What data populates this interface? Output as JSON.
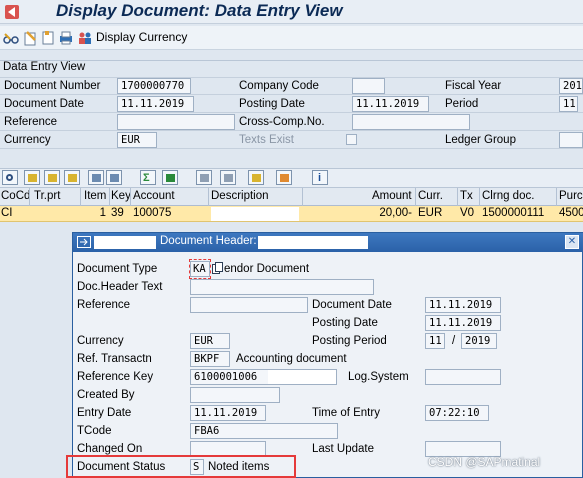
{
  "window": {
    "title": "Display Document: Data Entry View"
  },
  "toolbar": {
    "display_currency_label": "Display Currency",
    "icons": [
      "glasses-icon",
      "edit-icon",
      "document-icon",
      "print-icon",
      "people-icon"
    ]
  },
  "section": {
    "title": "Data Entry View"
  },
  "header_fields": {
    "document_number_label": "Document Number",
    "document_number_value": "1700000770",
    "company_code_label": "Company Code",
    "company_code_value": "",
    "fiscal_year_label": "Fiscal Year",
    "fiscal_year_value": "201",
    "document_date_label": "Document Date",
    "document_date_value": "11.11.2019",
    "posting_date_label": "Posting Date",
    "posting_date_value": "11.11.2019",
    "period_label": "Period",
    "period_value": "11",
    "reference_label": "Reference",
    "reference_value": "",
    "cross_comp_label": "Cross-Comp.No.",
    "cross_comp_value": "",
    "currency_label": "Currency",
    "currency_value": "EUR",
    "texts_exist_label": "Texts Exist",
    "ledger_group_label": "Ledger Group",
    "ledger_group_value": ""
  },
  "grid": {
    "columns": [
      "CoCd",
      "Tr.prt",
      "Item",
      "Key",
      "Account",
      "Description",
      "Amount",
      "Curr.",
      "Tx",
      "Clrng doc.",
      "Purc"
    ],
    "row": {
      "cocd": "CI",
      "trprt": "",
      "item": "1",
      "key": "39",
      "account": "100075",
      "description": "",
      "amount": "20,00-",
      "curr": "EUR",
      "tx": "V0",
      "clrng": "1500000111",
      "purc": "4500"
    }
  },
  "popup": {
    "title": "Document Header:",
    "document_type_label": "Document Type",
    "document_type_value": "KA",
    "document_type_desc": "endor Document",
    "doc_header_text_label": "Doc.Header Text",
    "doc_header_text_value": "",
    "reference_label": "Reference",
    "reference_value": "",
    "document_date_label": "Document Date",
    "document_date_value": "11.11.2019",
    "posting_date_label": "Posting Date",
    "posting_date_value": "11.11.2019",
    "currency_label": "Currency",
    "currency_value": "EUR",
    "posting_period_label": "Posting Period",
    "posting_period_month": "11",
    "posting_period_sep": "/",
    "posting_period_year": "2019",
    "ref_transactn_label": "Ref. Transactn",
    "ref_transactn_value": "BKPF",
    "ref_transactn_desc": "Accounting document",
    "reference_key_label": "Reference Key",
    "reference_key_value": "6100001006",
    "log_system_label": "Log.System",
    "log_system_value": "",
    "created_by_label": "Created By",
    "created_by_value": "",
    "entry_date_label": "Entry Date",
    "entry_date_value": "11.11.2019",
    "time_of_entry_label": "Time of Entry",
    "time_of_entry_value": "07:22:10",
    "tcode_label": "TCode",
    "tcode_value": "FBA6",
    "changed_on_label": "Changed On",
    "changed_on_value": "",
    "last_update_label": "Last Update",
    "last_update_value": "",
    "document_status_label": "Document Status",
    "document_status_value": "S",
    "document_status_desc": "Noted items"
  },
  "watermark": "CSDN @SAPmatinal"
}
